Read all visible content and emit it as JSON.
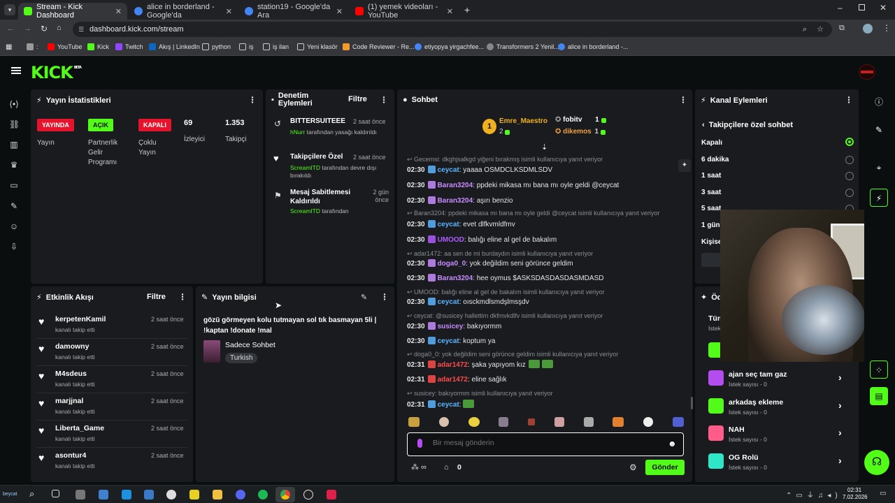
{
  "browser": {
    "tabs": [
      {
        "title": "Stream - Kick Dashboard",
        "color": "#53fc18"
      },
      {
        "title": "alice in borderland - Google'da",
        "color": "#4285f4"
      },
      {
        "title": "station19 - Google'da Ara",
        "color": "#4285f4"
      },
      {
        "title": "(1) yemek videoları - YouTube",
        "color": "#ff0000"
      }
    ],
    "url": "dashboard.kick.com/stream",
    "bookmarks": [
      "YouTube",
      "Kick",
      "Twitch",
      "Akış | LinkedIn",
      "python",
      "iş",
      "iş ilan",
      "Yeni klasör",
      "Code Reviewer - Re...",
      "etiyopya yirgachfee...",
      "Transformers 2 Yenil...",
      "alice in borderland -..."
    ]
  },
  "logo": "KICK",
  "logo_sup": "BETA",
  "stats": {
    "title": "Yayın İstatistikleri",
    "live_badge": "YAYINDA",
    "live_label": "Yayın",
    "partner_badge": "AÇIK",
    "partner_label": "Partnerlik Gelir Programı",
    "multi_badge": "KAPALI",
    "multi_label": "Çoklu Yayın",
    "viewers": "69",
    "viewers_label": "İzleyici",
    "followers": "1.353",
    "followers_label": "Takipçi"
  },
  "moderation": {
    "title": "Denetim Eylemleri",
    "filter": "Filtre",
    "items": [
      {
        "title": "BITTERSUITEEE",
        "time": "2 saat önce",
        "user": "hNurr",
        "text": "tarafından yasağı kaldırıldı"
      },
      {
        "title": "Takipçilere Özel",
        "time": "2 saat önce",
        "user": "ScreamITD",
        "text": "tarafından devre dışı bırakıldı"
      },
      {
        "title": "Mesaj Sabitlemesi Kaldırıldı",
        "time": "2 gün önce",
        "user": "ScreamITD",
        "text": "tarafından"
      }
    ]
  },
  "chat": {
    "title": "Sohbet",
    "top": [
      {
        "rank": "1",
        "name": "Emre_Maestro",
        "count": "2"
      },
      {
        "name": "fobitv",
        "count": "1"
      },
      {
        "name": "dikemos",
        "count": "1"
      }
    ],
    "lines": [
      {
        "type": "reply",
        "text": "Gecemsi: dkghjsalkgd yiğeni bırakmış isimli kullanıcıya yanıt veriyor"
      },
      {
        "type": "msg",
        "time": "02:30",
        "user": "ceycat",
        "color": "#5ab4ff",
        "text": "yaaaa OSMDCLKSDMLSDV"
      },
      {
        "type": "msg",
        "time": "02:30",
        "user": "Baran3204",
        "color": "#c88cff",
        "text": "ppdeki mikasa mı bana mı oyle geldi @ceycat"
      },
      {
        "type": "msg",
        "time": "02:30",
        "user": "Baran3204",
        "color": "#c88cff",
        "text": "aşırı benzio"
      },
      {
        "type": "reply",
        "text": "Baran3204: ppdeki mikasa mı bana mı oyle geldi @ceycat isimli kullanıcıya yanıt veriyor"
      },
      {
        "type": "msg",
        "time": "02:30",
        "user": "ceycat",
        "color": "#5ab4ff",
        "text": "evet dlfkvmldfmv"
      },
      {
        "type": "msg",
        "time": "02:30",
        "user": "UMOOD",
        "color": "#b05cff",
        "text": "balığı eline al gel de bakalım"
      },
      {
        "type": "reply",
        "text": "adar1472: aa sen de mi burdaydın isimli kullanıcıya yanıt veriyor"
      },
      {
        "type": "msg",
        "time": "02:30",
        "user": "doga0_0",
        "color": "#c88cff",
        "text": "yok değildim seni görünce geldim"
      },
      {
        "type": "msg",
        "time": "02:30",
        "user": "Baran3204",
        "color": "#c88cff",
        "text": "hee oymus $ASKSDASDASDASMDASD"
      },
      {
        "type": "reply",
        "text": "UMOOD: balığı eline al gel de bakalım isimli kullanıcıya yanıt veriyor"
      },
      {
        "type": "msg",
        "time": "02:30",
        "user": "ceycat",
        "color": "#5ab4ff",
        "text": "oısckmdlsmdşlmsşdv"
      },
      {
        "type": "reply",
        "text": "ceycat: @susicey hallettim dkfmvkdlfv isimli kullanıcıya yanıt veriyor"
      },
      {
        "type": "msg",
        "time": "02:30",
        "user": "susicey",
        "color": "#c88cff",
        "text": "bakıyormm"
      },
      {
        "type": "msg",
        "time": "02:30",
        "user": "ceycat",
        "color": "#5ab4ff",
        "text": "koptum ya"
      },
      {
        "type": "reply",
        "text": "doga0_0: yok değildim seni görünce geldim isimli kullanıcıya yanıt veriyor"
      },
      {
        "type": "msg",
        "time": "02:31",
        "user": "adar1472",
        "color": "#ff4b4b",
        "text": "şaka yapıyom kız"
      },
      {
        "type": "msg",
        "time": "02:31",
        "user": "adar1472",
        "color": "#ff4b4b",
        "text": "eline sağlık"
      },
      {
        "type": "reply",
        "text": "susicey: bakıyormm isimli kullanıcıya yanıt veriyor"
      },
      {
        "type": "msg",
        "time": "02:31",
        "user": "ceycat",
        "color": "#5ab4ff",
        "text": ""
      }
    ],
    "placeholder": "Bir mesaj gönderin",
    "count": "0",
    "send": "Gönder"
  },
  "channel_actions": {
    "title": "Kanal Eylemleri",
    "sub": "Takipçilere özel sohbet",
    "options": [
      "Kapalı",
      "6 dakika",
      "1 saat",
      "3 saat",
      "5 saat",
      "1 gün",
      "Kişise"
    ]
  },
  "activity": {
    "title": "Etkinlik Akışı",
    "filter": "Filtre",
    "items": [
      {
        "name": "kerpetenKamil",
        "time": "2 saat önce",
        "text": "kanalı takip etti"
      },
      {
        "name": "damowny",
        "time": "2 saat önce",
        "text": "kanalı takip etti"
      },
      {
        "name": "M4sdeus",
        "time": "2 saat önce",
        "text": "kanalı takip etti"
      },
      {
        "name": "marjjnal",
        "time": "2 saat önce",
        "text": "kanalı takip etti"
      },
      {
        "name": "Liberta_Game",
        "time": "2 saat önce",
        "text": "kanalı takip etti"
      },
      {
        "name": "asontur4",
        "time": "2 saat önce",
        "text": "kanalı takip etti"
      }
    ]
  },
  "stream_info": {
    "title": "Yayın bilgisi",
    "stream_title": "gözü görmeyen kolu tutmayan sol tık basmayan 5li | !kaptan !donate !mal",
    "category": "Sadece Sohbet",
    "language": "Turkish"
  },
  "rewards": {
    "title_partial": "Öd",
    "all_partial": "Tüm",
    "sub_partial": "İstek",
    "items": [
      {
        "name": "ajan seç tam gaz",
        "sub": "İstek sayısı - 0",
        "color": "#b44cf0"
      },
      {
        "name": "arkadaş ekleme",
        "sub": "İstek sayısı - 0",
        "color": "#53fc18"
      },
      {
        "name": "NAH",
        "sub": "İstek sayısı - 0",
        "color": "#ff5c8a"
      },
      {
        "name": "OG Rolü",
        "sub": "İstek sayısı - 0",
        "color": "#2ee6c8"
      }
    ]
  },
  "taskbar": {
    "time": "02:31",
    "date": "7.02.2026",
    "user": "beycat"
  }
}
